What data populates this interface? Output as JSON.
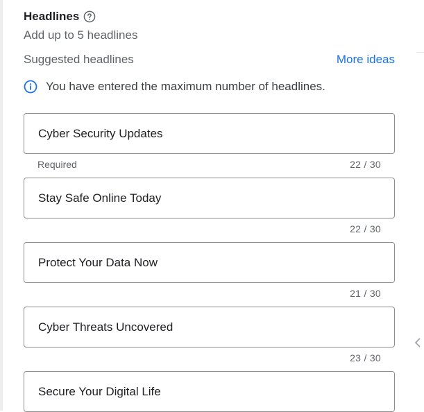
{
  "header": {
    "title": "Headlines",
    "help_icon": "help-circle-icon",
    "subtitle": "Add up to 5 headlines"
  },
  "suggestions": {
    "label": "Suggested headlines",
    "more_ideas": "More ideas"
  },
  "notice": {
    "icon": "info-icon",
    "text": "You have entered the maximum number of headlines."
  },
  "headlines": [
    {
      "value": "Cyber Security Updates",
      "helper": "Required",
      "counter": "22 / 30"
    },
    {
      "value": "Stay Safe Online Today",
      "helper": "",
      "counter": "22 / 30"
    },
    {
      "value": "Protect Your Data Now",
      "helper": "",
      "counter": "21 / 30"
    },
    {
      "value": "Cyber Threats Uncovered",
      "helper": "",
      "counter": "23 / 30"
    },
    {
      "value": "Secure Your Digital Life",
      "helper": "",
      "counter": ""
    }
  ],
  "colors": {
    "accent": "#1a73e8",
    "text": "#202124",
    "secondary_text": "#5f6368",
    "border": "#8c8c8c"
  }
}
